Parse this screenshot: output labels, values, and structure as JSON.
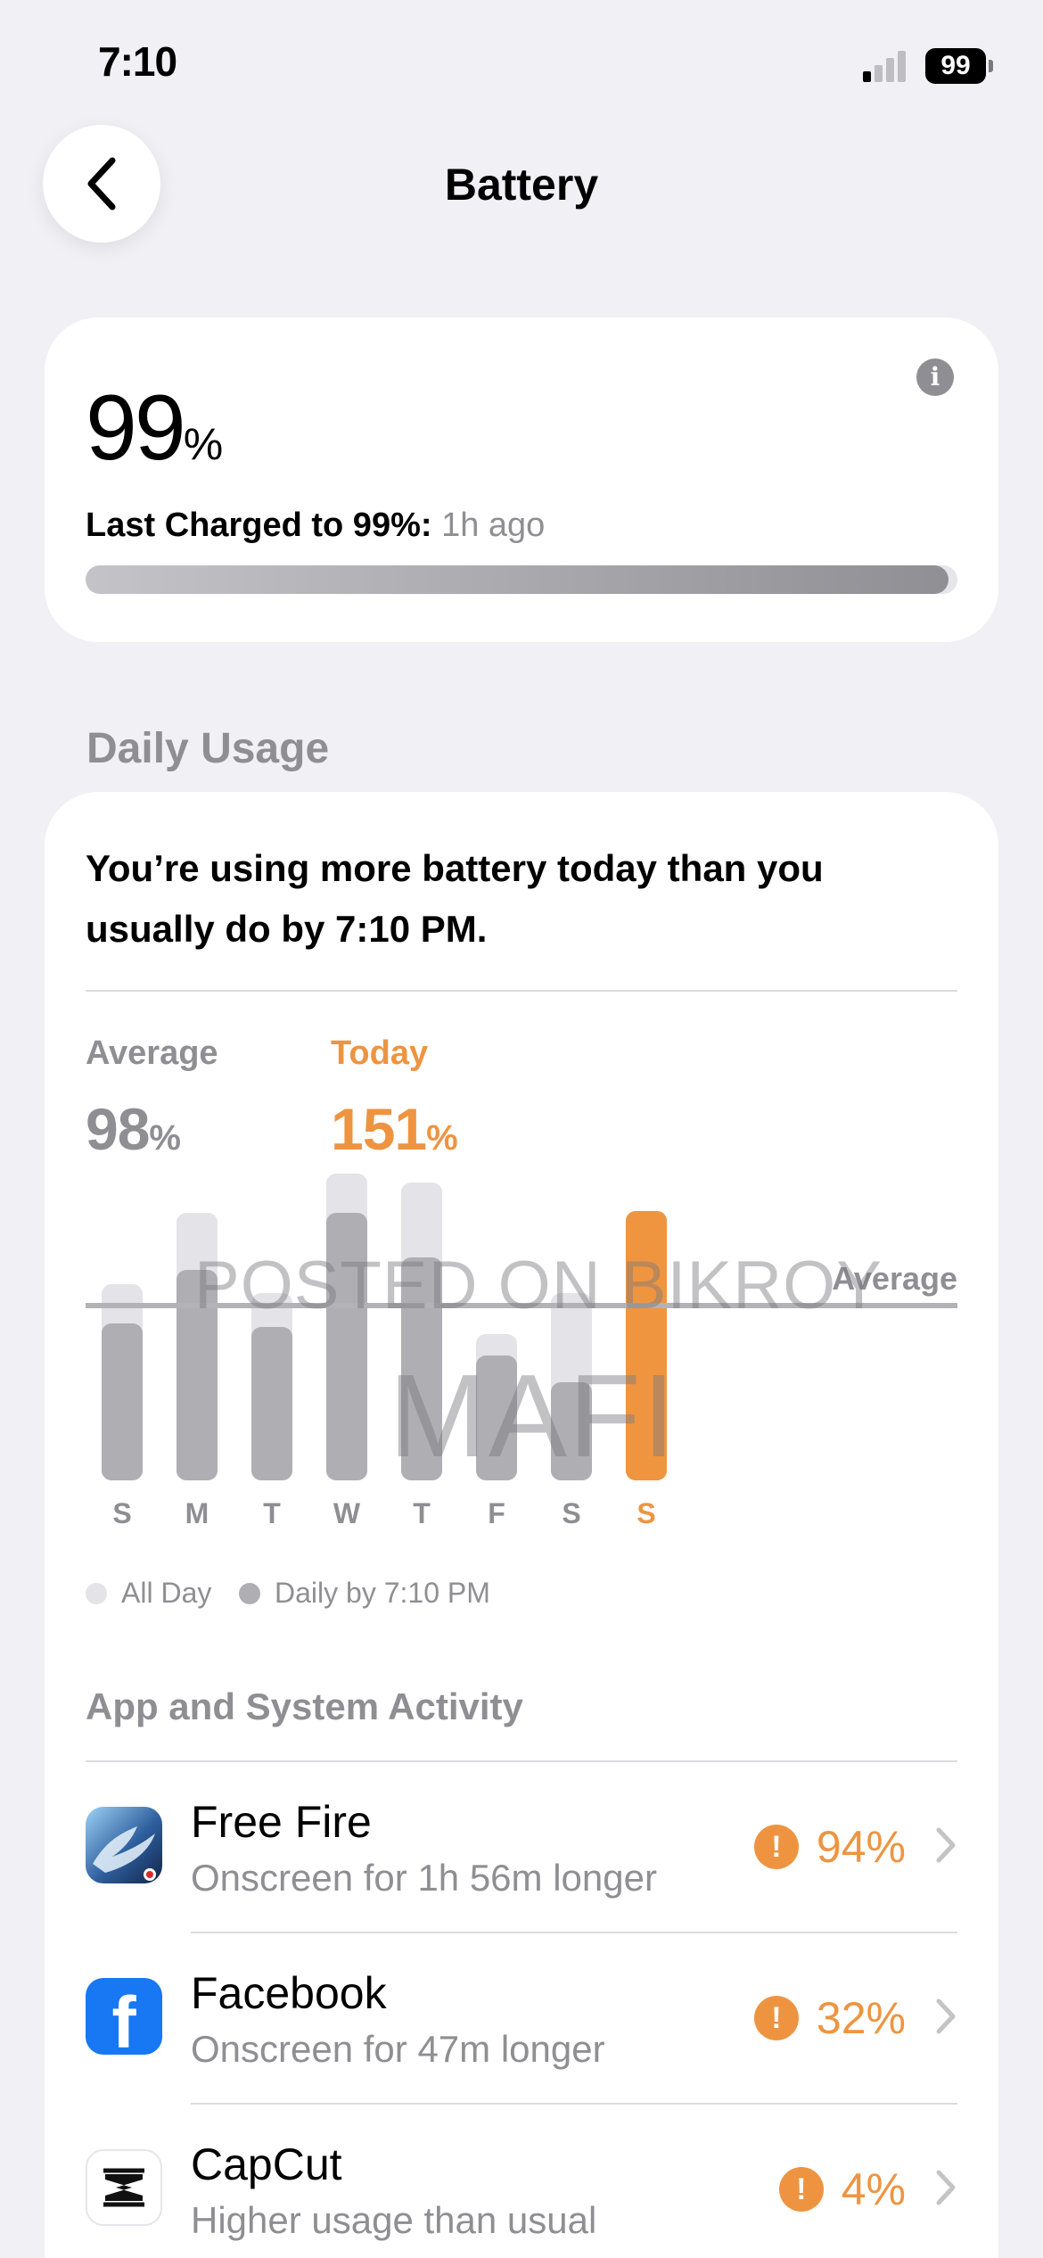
{
  "status_bar": {
    "time": "7:10",
    "battery_level": "99",
    "signal_bars_on": 1,
    "signal_bars_total": 4
  },
  "nav": {
    "title": "Battery",
    "back_icon": "chevron-left-icon"
  },
  "battery_level": {
    "value": "99",
    "unit": "%",
    "last_charged_label": "Last Charged to 99%:",
    "last_charged_ago": "1h ago",
    "level_fraction": 0.99,
    "info_icon": "info-icon",
    "info_glyph": "i"
  },
  "daily_usage": {
    "section_title": "Daily Usage",
    "message": "You’re using more battery today than you usually do by 7:10 PM.",
    "average": {
      "label": "Average",
      "value": "98",
      "unit": "%"
    },
    "today": {
      "label": "Today",
      "value": "151",
      "unit": "%"
    },
    "chart_data": {
      "type": "bar",
      "categories": [
        "S",
        "M",
        "T",
        "W",
        "T",
        "F",
        "S",
        "S"
      ],
      "series": [
        {
          "name": "All Day",
          "values": [
            110,
            150,
            105,
            172,
            167,
            82,
            105,
            151
          ]
        },
        {
          "name": "Daily by 7:10 PM",
          "values": [
            88,
            118,
            86,
            150,
            125,
            70,
            55,
            151
          ]
        }
      ],
      "highlight_index": 7,
      "reference_line": {
        "label": "Average",
        "value": 98
      },
      "ylim": [
        0,
        180
      ],
      "colors": {
        "all_day": "#e4e4e8",
        "by_time": "#aeaeb3",
        "highlight_all_day": "#f6c090",
        "highlight_by_time": "#f0953f",
        "label": "#8e8e93",
        "highlight_label": "#ee9441"
      }
    },
    "legend": [
      {
        "label": "All Day",
        "color": "#e4e4e8"
      },
      {
        "label": "Daily by 7:10 PM",
        "color": "#aeaeb3"
      }
    ]
  },
  "activity": {
    "title": "App and System Activity",
    "alert_glyph": "!",
    "apps": [
      {
        "name": "Free Fire",
        "detail": "Onscreen for 1h 56m longer",
        "percent": "94%",
        "icon": "free-fire-icon"
      },
      {
        "name": "Facebook",
        "detail": "Onscreen for 47m longer",
        "percent": "32%",
        "icon": "facebook-icon",
        "icon_glyph": "f"
      },
      {
        "name": "CapCut",
        "detail": "Higher usage than usual",
        "percent": "4%",
        "icon": "capcut-icon"
      }
    ]
  },
  "watermark": {
    "line1": "POSTED ON BIKROY",
    "line2": "MAFI"
  }
}
